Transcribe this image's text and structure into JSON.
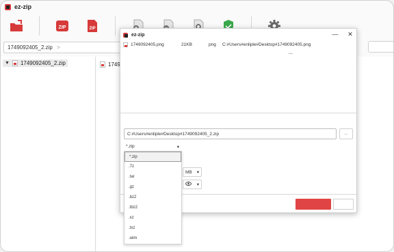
{
  "app": {
    "title": "ez-zip"
  },
  "toolbar": {
    "buttons": [
      {
        "name": "open-folder-icon",
        "color": "#d73a3a"
      },
      {
        "name": "zip-compress-icon",
        "color": "#d73a3a",
        "label": "ZIP"
      },
      {
        "name": "zip-extract-icon",
        "color": "#d73a3a",
        "label": "ZIP"
      },
      {
        "name": "add-file-icon",
        "color": "#777777"
      },
      {
        "name": "remove-file-icon",
        "color": "#777777"
      },
      {
        "name": "search-file-icon",
        "color": "#777777"
      },
      {
        "name": "check-shield-icon",
        "color": "#3aa84a"
      },
      {
        "name": "settings-gear-icon",
        "color": "#666666"
      }
    ]
  },
  "pathbar": {
    "value": "1749092405_2.zip",
    "separator": ">"
  },
  "tree": {
    "items": [
      {
        "label": "1749092405_2.zip"
      }
    ]
  },
  "file_list": {
    "first_item_partial": "1749"
  },
  "dialog": {
    "title": "ez-zip",
    "file_row": {
      "name": "1749092405.png",
      "size": "21KB",
      "type": "png",
      "path": "C:#Users#enliple#Desktop#1749092405.png"
    },
    "dash": "—",
    "output_path": "C:#Users#enliple#Desktop#1749092405_2.zip",
    "browse_label": "...",
    "format": {
      "value": "*.zip"
    },
    "unit": {
      "value": "MB"
    },
    "eye_select": {
      "value": ""
    },
    "ok_color": "#e04444"
  },
  "dropdown": {
    "options": [
      "*.zip",
      ".7z",
      ".tar",
      ".gz",
      ".bz2",
      ".tbz2",
      ".xz",
      ".txz",
      ".wim"
    ],
    "selected_index": 0
  }
}
